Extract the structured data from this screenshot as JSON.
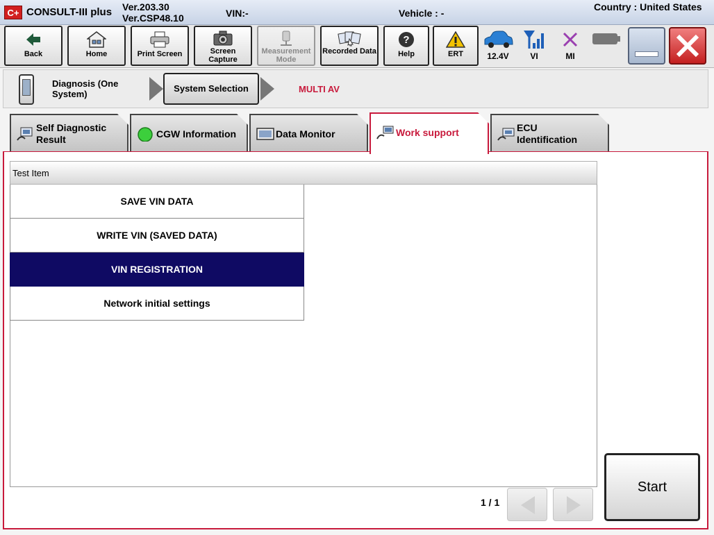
{
  "titlebar": {
    "logo": "C+",
    "app_name": "CONSULT-III plus",
    "version_line1": "Ver.203.30",
    "version_line2": "Ver.CSP48.10",
    "vin": "VIN:-",
    "vehicle": "Vehicle : -",
    "country": "Country : United States"
  },
  "toolbar": {
    "back": "Back",
    "home": "Home",
    "print_screen": "Print Screen",
    "screen_capture": "Screen Capture",
    "measurement_mode": "Measurement Mode",
    "recorded_data": "Recorded Data",
    "help": "Help",
    "ert": "ERT"
  },
  "status": {
    "battery_voltage": "12.4V",
    "vi": "VI",
    "mi": "MI"
  },
  "breadcrumb": {
    "item1": "Diagnosis (One System)",
    "item2": "System Selection",
    "current": "MULTI AV"
  },
  "tabs": [
    {
      "label": "Self Diagnostic Result"
    },
    {
      "label": "CGW Information"
    },
    {
      "label": "Data Monitor"
    },
    {
      "label": "Work support"
    },
    {
      "label": "ECU Identification"
    }
  ],
  "test_items": {
    "header": "Test Item",
    "rows": [
      {
        "label": "SAVE VIN DATA"
      },
      {
        "label": "WRITE VIN (SAVED DATA)"
      },
      {
        "label": "VIN REGISTRATION"
      },
      {
        "label": "Network initial settings"
      }
    ]
  },
  "pagination": {
    "indicator": "1 / 1"
  },
  "start_button": "Start",
  "colors": {
    "accent": "#c81a3c",
    "selected_row": "#0f0a63"
  }
}
